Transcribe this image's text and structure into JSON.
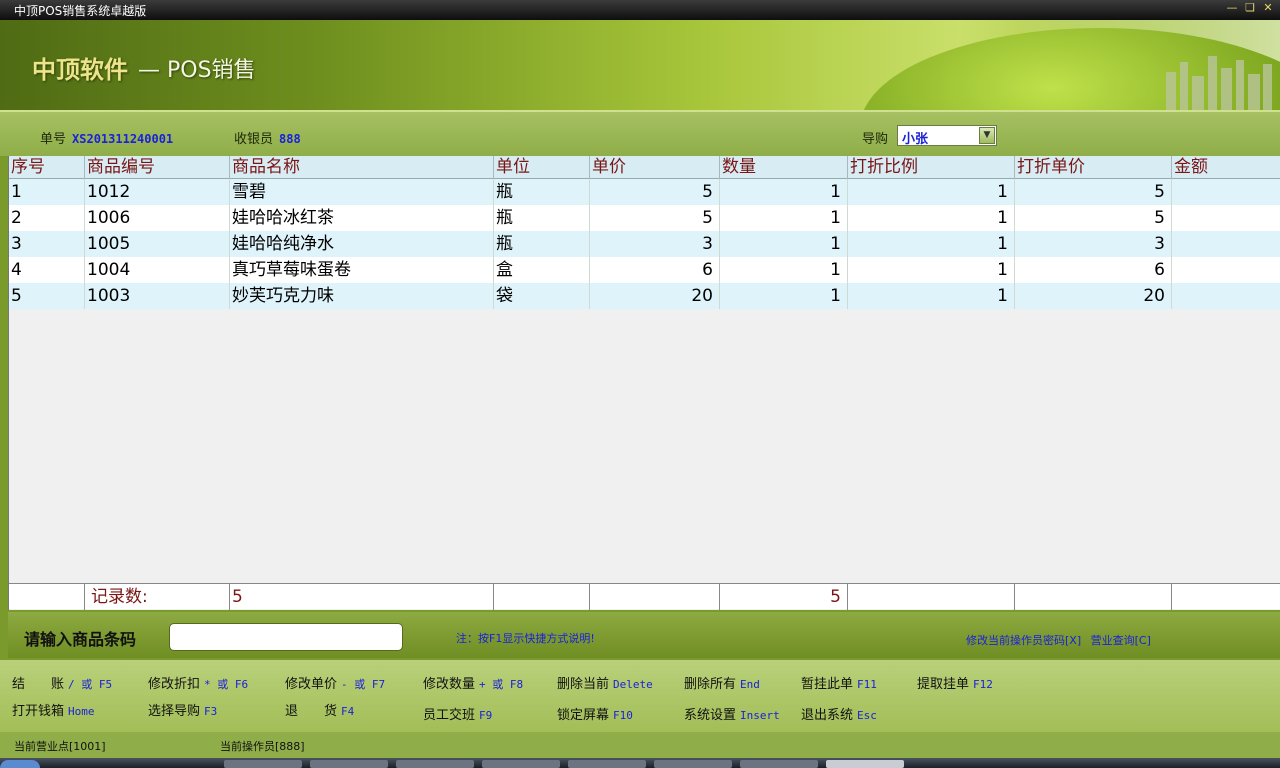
{
  "window": {
    "title": "中顶POS销售系统卓越版"
  },
  "banner": {
    "brand": "中顶软件",
    "subtitle": "— POS销售"
  },
  "info": {
    "order_label": "单号",
    "order_value": "XS201311240001",
    "cashier_label": "收银员",
    "cashier_value": "888",
    "guide_label": "导购",
    "guide_value": "小张"
  },
  "grid": {
    "headers": [
      "序号",
      "商品编号",
      "商品名称",
      "单位",
      "单价",
      "数量",
      "打折比例",
      "打折单价",
      "金额"
    ],
    "rows": [
      [
        "1",
        "1012",
        "雪碧",
        "瓶",
        "5",
        "1",
        "1",
        "5",
        ""
      ],
      [
        "2",
        "1006",
        "娃哈哈冰红茶",
        "瓶",
        "5",
        "1",
        "1",
        "5",
        ""
      ],
      [
        "3",
        "1005",
        "娃哈哈纯净水",
        "瓶",
        "3",
        "1",
        "1",
        "3",
        ""
      ],
      [
        "4",
        "1004",
        "真巧草莓味蛋卷",
        "盒",
        "6",
        "1",
        "1",
        "6",
        ""
      ],
      [
        "5",
        "1003",
        "妙芙巧克力味",
        "袋",
        "20",
        "1",
        "1",
        "20",
        ""
      ]
    ],
    "footer": {
      "count_label": "记录数:",
      "count_value": "5",
      "qty_total": "5"
    }
  },
  "barcode": {
    "label": "请输入商品条码",
    "value": "",
    "note": "注：按F1显示快捷方式说明!",
    "change_password": "修改当前操作员密码[X]",
    "business_query": "营业查询[C]"
  },
  "fkeys": {
    "checkout": {
      "label": "结　　账",
      "key": "/ 或 F5"
    },
    "discount": {
      "label": "修改折扣",
      "key": "* 或 F6"
    },
    "price": {
      "label": "修改单价",
      "key": "- 或 F7"
    },
    "qty": {
      "label": "修改数量",
      "key": "+ 或 F8"
    },
    "delete_current": {
      "label": "删除当前",
      "key": "Delete"
    },
    "delete_all": {
      "label": "删除所有",
      "key": "End"
    },
    "hold": {
      "label": "暂挂此单",
      "key": "F11"
    },
    "retrieve": {
      "label": "提取挂单",
      "key": "F12"
    },
    "cash_drawer": {
      "label": "打开钱箱",
      "key": "Home"
    },
    "choose_guide": {
      "label": "选择导购",
      "key": "F3"
    },
    "return": {
      "label": "退　　货",
      "key": "F4"
    },
    "shift": {
      "label": "员工交班",
      "key": "F9"
    },
    "lock": {
      "label": "锁定屏幕",
      "key": "F10"
    },
    "settings": {
      "label": "系统设置",
      "key": "Insert"
    },
    "exit": {
      "label": "退出系统",
      "key": "Esc"
    }
  },
  "status": {
    "store": "当前营业点[1001]",
    "operator": "当前操作员[888]"
  },
  "colors": {
    "accent_green": "#7a9b2c",
    "link_blue": "#1b21d9",
    "header_red": "#7a1616",
    "row_tint": "#dff3fa"
  }
}
